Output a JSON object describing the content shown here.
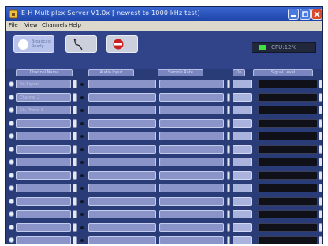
{
  "window": {
    "title": "E-H Multiplex Server V1.0x   [ newest to 1000 kHz test]"
  },
  "menu": {
    "items": [
      {
        "label": "File"
      },
      {
        "label": "View"
      },
      {
        "label": "Channels"
      },
      {
        "label": "Help"
      }
    ]
  },
  "toolbar": {
    "play_label": "Broadcast Ready",
    "status_text": "CPU:12%"
  },
  "columns": {
    "name": "Channel Name",
    "device": "Audio Input",
    "format": "Sample Rate",
    "enable": "On",
    "level": "Signal Level"
  },
  "rows": [
    {
      "name": "No Signal"
    },
    {
      "name": "Channel 2"
    },
    {
      "name": "Ch. Phone 3"
    },
    {
      "name": ""
    },
    {
      "name": ""
    },
    {
      "name": ""
    },
    {
      "name": ""
    },
    {
      "name": ""
    },
    {
      "name": ""
    },
    {
      "name": ""
    },
    {
      "name": ""
    },
    {
      "name": ""
    },
    {
      "name": ""
    }
  ],
  "colors": {
    "window_bg": "#2a3c78",
    "field_bg": "#8a94c8",
    "level_display": "#101018",
    "status_led": "#40e040",
    "record_icon": "#cc2020"
  },
  "icons": {
    "app": "app-icon",
    "play": "play-knob-icon",
    "wave": "waveform-icon",
    "record": "record-icon"
  }
}
